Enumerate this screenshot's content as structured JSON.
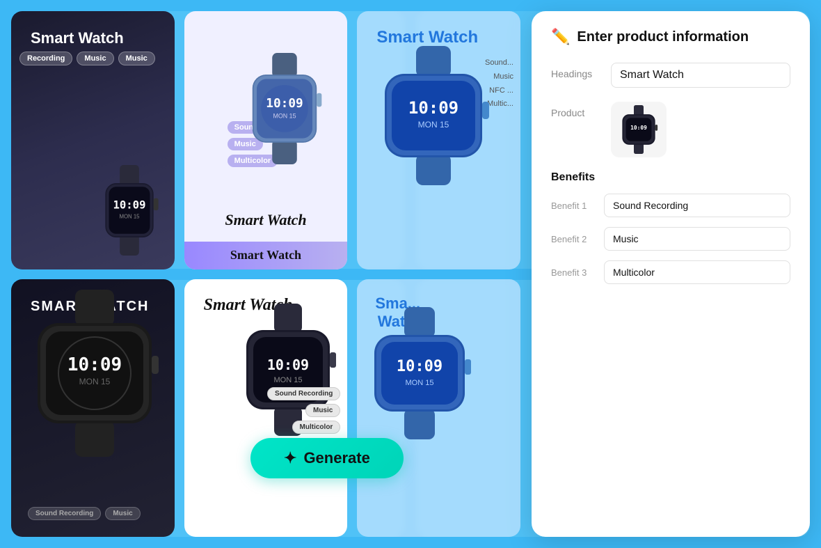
{
  "background": {
    "color": "#3db8f5"
  },
  "cards": [
    {
      "id": 1,
      "style": "dark",
      "title": "Smart Watch",
      "tags": [
        "Recording",
        "Music",
        "Music"
      ],
      "watch_color": "dark"
    },
    {
      "id": 2,
      "style": "light-purple",
      "title": "Smart Watch",
      "tags": [
        "Sound Recording",
        "Music",
        "Multicolor"
      ],
      "watch_color": "silver-blue"
    },
    {
      "id": 3,
      "style": "blue-transparent",
      "title": "Smart Watch",
      "text_list": [
        "Sound...",
        "Music",
        "NFC...",
        "Multic..."
      ],
      "watch_color": "blue"
    },
    {
      "id": 4,
      "style": "dark",
      "title": "SMART WATCH",
      "tags": [
        "Sound Recording",
        "Music"
      ],
      "watch_color": "dark-large"
    },
    {
      "id": 5,
      "style": "white",
      "title": "Smart Watch",
      "tags": [
        "Sound Recording",
        "Music",
        "Multicolor"
      ],
      "watch_color": "dark"
    },
    {
      "id": 6,
      "style": "blue-transparent",
      "title": "Sma... Wat...",
      "tags": [],
      "watch_color": "blue"
    }
  ],
  "generate_button": {
    "label": "Generate",
    "icon": "✦"
  },
  "panel": {
    "title": "Enter product information",
    "icon": "✏️",
    "headings_label": "Headings",
    "headings_value": "Smart Watch",
    "product_label": "Product",
    "benefits_section_title": "Benefits",
    "benefits": [
      {
        "label": "Benefit 1",
        "value": "Sound Recording"
      },
      {
        "label": "Benefit 2",
        "value": "Music"
      },
      {
        "label": "Benefit 3",
        "value": "Multicolor"
      }
    ]
  }
}
